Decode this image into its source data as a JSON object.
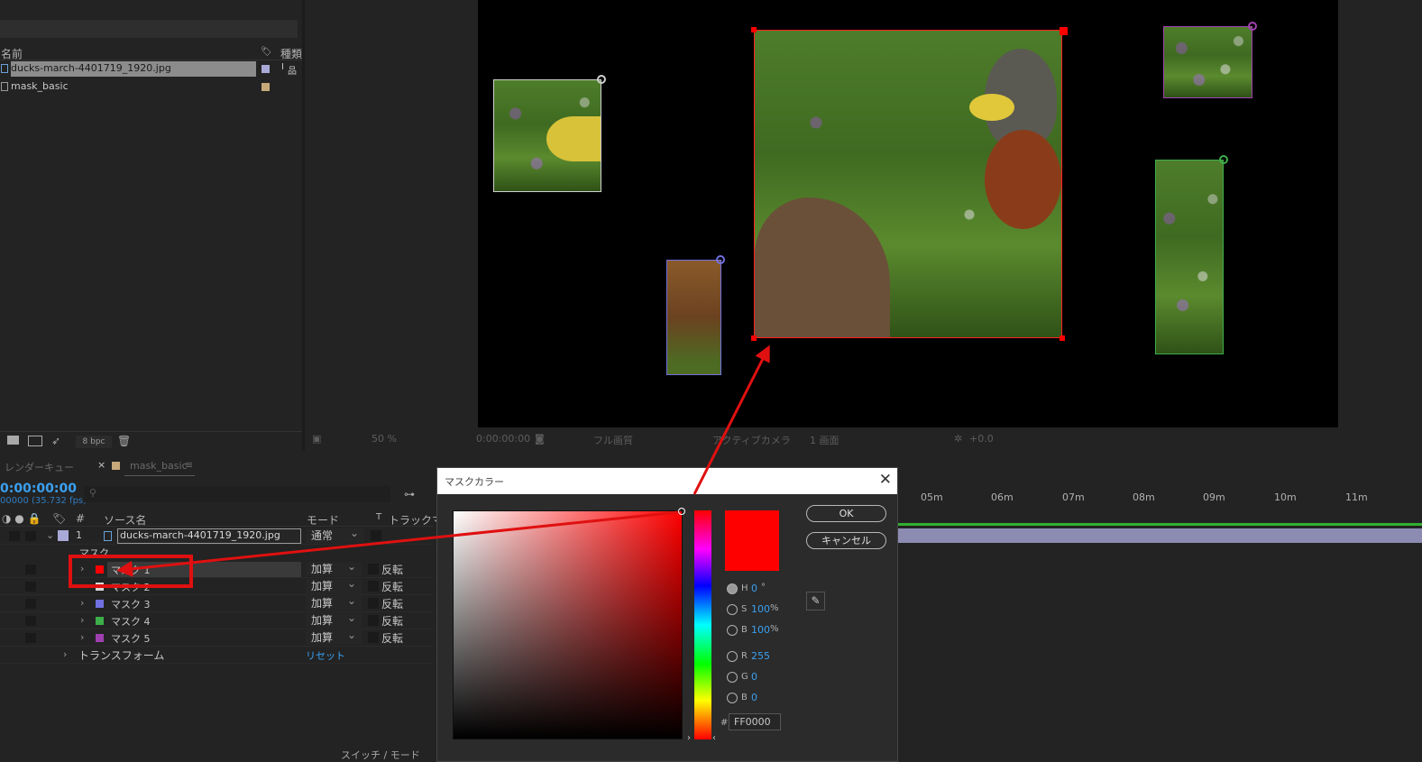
{
  "project": {
    "col_name": "名前",
    "col_type": "種類",
    "items": [
      {
        "name": "ducks-march-4401719_1920.jpg",
        "color": "#a9a9d8",
        "selected": true
      },
      {
        "name": "mask_basic",
        "color": "#c7a97a",
        "selected": false
      }
    ],
    "bpc_label": "8 bpc"
  },
  "viewer": {
    "zoom": "50 %",
    "timecode": "0:00:00:00",
    "quality": "フル画質",
    "camera": "アクティブカメラ",
    "views": "1 画面",
    "exposure": "+0.0"
  },
  "timeline": {
    "tab_render": "レンダーキュー",
    "tab_comp": "mask_basic",
    "timecode": "0:00:00:00",
    "fps": "00000 (35.732 fps)",
    "headers": {
      "num": "#",
      "source": "ソース名",
      "mode": "モード",
      "t": "T",
      "trackmatte": "トラックマット"
    },
    "layer": {
      "num": "1",
      "name": "ducks-march-4401719_1920.jpg",
      "mode": "通常"
    },
    "mask_group": "マスク",
    "masks": [
      {
        "name": "マスク 1",
        "color": "#ff0000",
        "mode": "加算",
        "invert": "反転"
      },
      {
        "name": "マスク 2",
        "color": "#d8d8d8",
        "mode": "加算",
        "invert": "反転"
      },
      {
        "name": "マスク 3",
        "color": "#7070e0",
        "mode": "加算",
        "invert": "反転"
      },
      {
        "name": "マスク 4",
        "color": "#3cae4a",
        "mode": "加算",
        "invert": "反転"
      },
      {
        "name": "マスク 5",
        "color": "#a040b0",
        "mode": "加算",
        "invert": "反転"
      }
    ],
    "transform": "トランスフォーム",
    "reset": "リセット",
    "ruler": [
      "05m",
      "06m",
      "07m",
      "08m",
      "09m",
      "10m",
      "11m"
    ],
    "footer": "スイッチ / モード"
  },
  "dialog": {
    "title": "マスクカラー",
    "ok": "OK",
    "cancel": "キャンセル",
    "h_label": "H",
    "h_value": "0",
    "h_unit": "°",
    "s_label": "S",
    "s_value": "100",
    "s_unit": "%",
    "b_label": "B",
    "b_value": "100",
    "b_unit": "%",
    "r_label": "R",
    "r_value": "255",
    "g_label": "G",
    "g_value": "0",
    "bb_label": "B",
    "bb_value": "0",
    "hash": "#",
    "hex": "FF0000"
  }
}
